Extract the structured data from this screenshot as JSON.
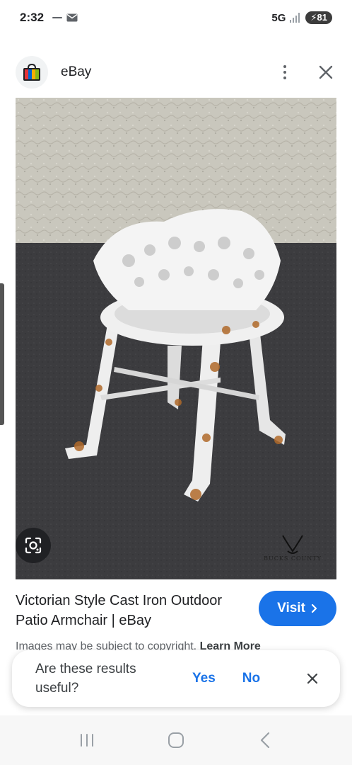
{
  "status_bar": {
    "time": "2:32",
    "network": "5G",
    "battery": "81"
  },
  "source": {
    "name": "eBay",
    "icons": {
      "logo": "ebay-bag-icon",
      "more": "more-vert-icon",
      "close": "close-icon"
    }
  },
  "image": {
    "watermark": "BUCKS COUNTY",
    "lens_icon": "google-lens-icon"
  },
  "result": {
    "title": "Victorian Style Cast Iron Outdoor Patio Armchair | eBay",
    "visit_label": "Visit",
    "copyright_text": "Images may be subject to copyright.",
    "learn_more": "Learn More"
  },
  "feedback": {
    "question": "Are these results useful?",
    "yes_label": "Yes",
    "no_label": "No"
  },
  "colors": {
    "accent": "#1a73e8",
    "text": "#202124",
    "muted": "#5f6368"
  }
}
